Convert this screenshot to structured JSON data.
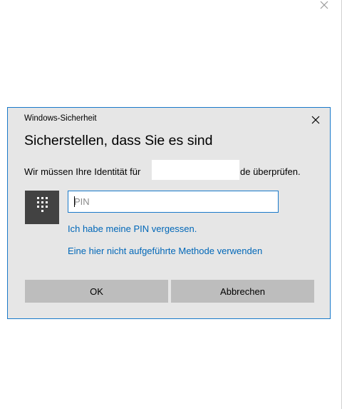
{
  "dialog": {
    "window_title": "Windows-Sicherheit",
    "heading": "Sicherstellen, dass Sie es sind",
    "prompt_prefix": "Wir müssen Ihre Identität für",
    "prompt_suffix": "de überprüfen.",
    "pin_placeholder": "PIN",
    "pin_value": "",
    "forgot_pin_link": "Ich habe meine PIN vergessen.",
    "other_method_link": "Eine hier nicht aufgeführte Methode verwenden",
    "ok_label": "OK",
    "cancel_label": "Abbrechen"
  },
  "icons": {
    "page_close": "close-icon",
    "dialog_close": "close-icon",
    "pin_tile": "keypad-icon"
  },
  "colors": {
    "accent": "#1979ca",
    "link": "#0067b8",
    "dialog_bg": "#e6e6e6",
    "button_bg": "#bdbdbd",
    "pin_tile_bg": "#424242"
  }
}
